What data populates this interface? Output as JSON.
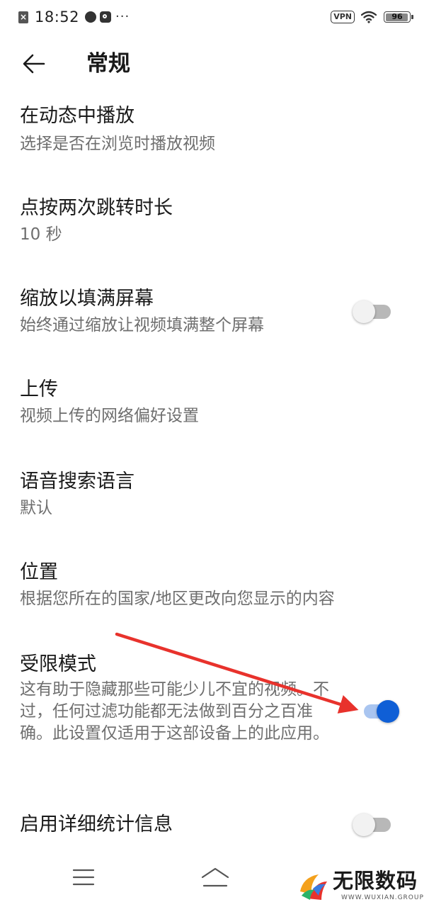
{
  "status_bar": {
    "time": "18:52",
    "more": "···",
    "vpn": "VPN",
    "battery_level": 96,
    "battery_text": "96"
  },
  "header": {
    "title": "常规"
  },
  "settings": [
    {
      "title": "在动态中播放",
      "subtitle": "选择是否在浏览时播放视频"
    },
    {
      "title": "点按两次跳转时长",
      "subtitle": "10 秒"
    },
    {
      "title": "缩放以填满屏幕",
      "subtitle": "始终通过缩放让视频填满整个屏幕",
      "toggle": false
    },
    {
      "title": "上传",
      "subtitle": "视频上传的网络偏好设置"
    },
    {
      "title": "语音搜索语言",
      "subtitle": "默认"
    },
    {
      "title": "位置",
      "subtitle": "根据您所在的国家/地区更改向您显示的内容"
    },
    {
      "title": "受限模式",
      "subtitle": "这有助于隐藏那些可能少儿不宜的视频。不过，任何过滤功能都无法做到百分之百准确。此设置仅适用于这部设备上的此应用。",
      "toggle": true
    },
    {
      "title": "启用详细统计信息",
      "toggle": false
    }
  ],
  "watermark": {
    "title": "无限数码",
    "subtitle": "WWW.WUXIAN.GROUP"
  },
  "colors": {
    "accent": "#0f5fd6",
    "annotation": "#e8322c"
  }
}
